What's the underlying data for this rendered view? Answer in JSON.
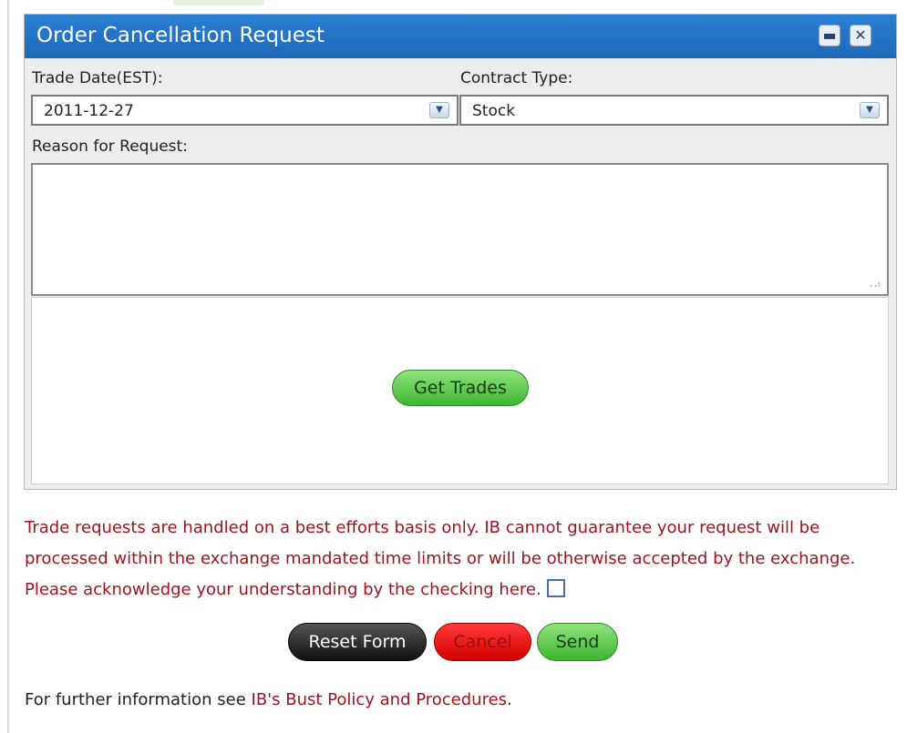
{
  "dialog": {
    "title": "Order Cancellation Request",
    "minimize_glyph": "▬",
    "close_glyph": "✕"
  },
  "form": {
    "trade_date_label": "Trade Date(EST):",
    "trade_date_value": "2011-12-27",
    "contract_type_label": "Contract Type:",
    "contract_type_value": "Stock",
    "reason_label": "Reason for Request:",
    "reason_value": "",
    "get_trades_label": "Get Trades"
  },
  "notice": {
    "text": "Trade requests are handled on a best efforts basis only. IB cannot guarantee your request will be processed within the exchange mandated time limits or will be otherwise accepted by the exchange. Please acknowledge your understanding by the checking here.",
    "acknowledged": false
  },
  "actions": {
    "reset_label": "Reset Form",
    "cancel_label": "Cancel",
    "send_label": "Send"
  },
  "footer": {
    "prefix": "For further information see ",
    "link_text": "IB's Bust Policy and Procedures",
    "suffix": "."
  },
  "icons": {
    "dropdown": "chevron-down-icon",
    "minimize": "minimize-icon",
    "close": "close-icon",
    "resize": "resize-grip-icon"
  },
  "colors": {
    "titlebar": "#1f68b8",
    "notice_text": "#a0141e",
    "green_button": "#3fb632",
    "red_button": "#d40000",
    "black_button": "#111111"
  }
}
